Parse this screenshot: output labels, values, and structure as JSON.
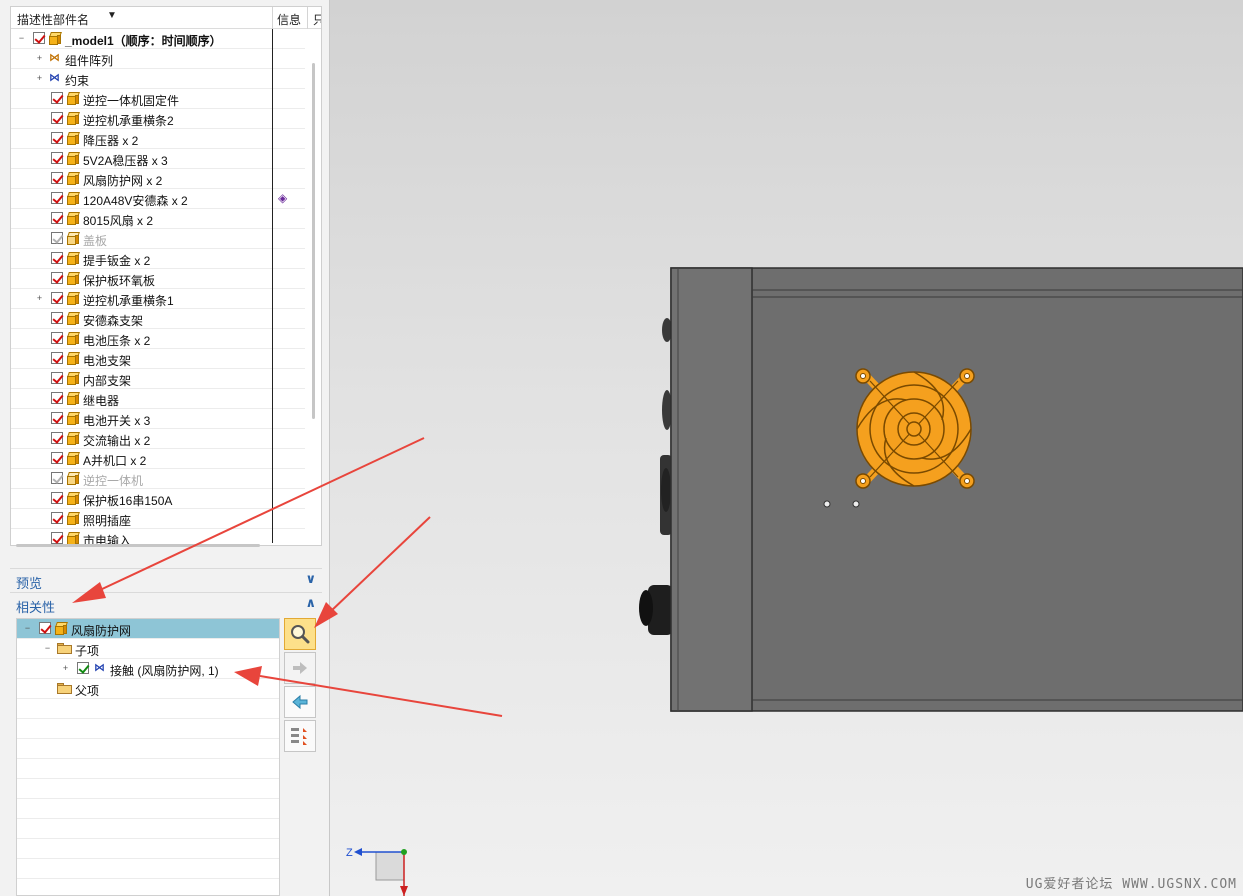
{
  "tree": {
    "columns": {
      "name": "描述性部件名",
      "sort_icon": "sort-down-icon",
      "info": "信息",
      "extra": "只"
    },
    "rows": [
      {
        "label": "_model1（顺序：时间顺序）",
        "indent": 0,
        "expander": "−",
        "check": "red",
        "icon": "assembly",
        "bold": true
      },
      {
        "label": "组件阵列",
        "indent": 1,
        "expander": "+",
        "check": "none",
        "icon": "pattern"
      },
      {
        "label": "约束",
        "indent": 1,
        "expander": "+",
        "check": "none",
        "icon": "constraint"
      },
      {
        "label": "逆控一体机固定件",
        "indent": 2,
        "check": "red",
        "icon": "part"
      },
      {
        "label": "逆控机承重横条2",
        "indent": 2,
        "check": "red",
        "icon": "part"
      },
      {
        "label": "降压器 x 2",
        "indent": 2,
        "check": "red",
        "icon": "part"
      },
      {
        "label": "5V2A稳压器 x 3",
        "indent": 2,
        "check": "red",
        "icon": "part"
      },
      {
        "label": "风扇防护网 x 2",
        "indent": 2,
        "check": "red",
        "icon": "part"
      },
      {
        "label": "120A48V安德森 x 2",
        "indent": 2,
        "check": "red",
        "icon": "part-alt",
        "info": "eraser-icon"
      },
      {
        "label": "8015风扇 x 2",
        "indent": 2,
        "check": "red",
        "icon": "part"
      },
      {
        "label": "盖板",
        "indent": 2,
        "check": "gray",
        "icon": "part-dim",
        "dim": true
      },
      {
        "label": "提手钣金 x 2",
        "indent": 2,
        "check": "red",
        "icon": "part"
      },
      {
        "label": "保护板环氧板",
        "indent": 2,
        "check": "red",
        "icon": "part"
      },
      {
        "label": "逆控机承重横条1",
        "indent": 2,
        "expander": "+",
        "check": "red",
        "icon": "assembly"
      },
      {
        "label": "安德森支架",
        "indent": 2,
        "check": "red",
        "icon": "part"
      },
      {
        "label": "电池压条 x 2",
        "indent": 2,
        "check": "red",
        "icon": "part"
      },
      {
        "label": "电池支架",
        "indent": 2,
        "check": "red",
        "icon": "part"
      },
      {
        "label": "内部支架",
        "indent": 2,
        "check": "red",
        "icon": "part"
      },
      {
        "label": "继电器",
        "indent": 2,
        "check": "red",
        "icon": "part"
      },
      {
        "label": "电池开关 x 3",
        "indent": 2,
        "check": "red",
        "icon": "part"
      },
      {
        "label": "交流输出 x 2",
        "indent": 2,
        "check": "red",
        "icon": "part"
      },
      {
        "label": "A并机口 x 2",
        "indent": 2,
        "check": "red",
        "icon": "part"
      },
      {
        "label": "逆控一体机",
        "indent": 2,
        "check": "gray",
        "icon": "part-dim",
        "dim": true
      },
      {
        "label": "保护板16串150A",
        "indent": 2,
        "check": "red",
        "icon": "part"
      },
      {
        "label": "照明插座",
        "indent": 2,
        "check": "red",
        "icon": "part"
      },
      {
        "label": "市电输入",
        "indent": 2,
        "check": "red",
        "icon": "part"
      }
    ]
  },
  "preview": {
    "title": "预览",
    "chevron": "chevron-down-icon"
  },
  "dependency": {
    "title": "相关性",
    "chevron": "chevron-up-icon",
    "rows": [
      {
        "label": "风扇防护网",
        "type": "part",
        "selected": true
      },
      {
        "label": "子项",
        "type": "folder"
      },
      {
        "label": "接触 (风扇防护网, 1)",
        "type": "constraint"
      },
      {
        "label": "父项",
        "type": "folder"
      }
    ],
    "tools": [
      "magnifier-icon",
      "arrow-right-icon",
      "arrow-left-icon",
      "list-expand-icon"
    ]
  },
  "viewport": {
    "watermark": "UG爱好者论坛 WWW.UGSNX.COM",
    "triad_label": "Z",
    "colors": {
      "body": "#6e6e6e",
      "fan": "#f5a01e",
      "arrow": "#e8453c"
    }
  }
}
